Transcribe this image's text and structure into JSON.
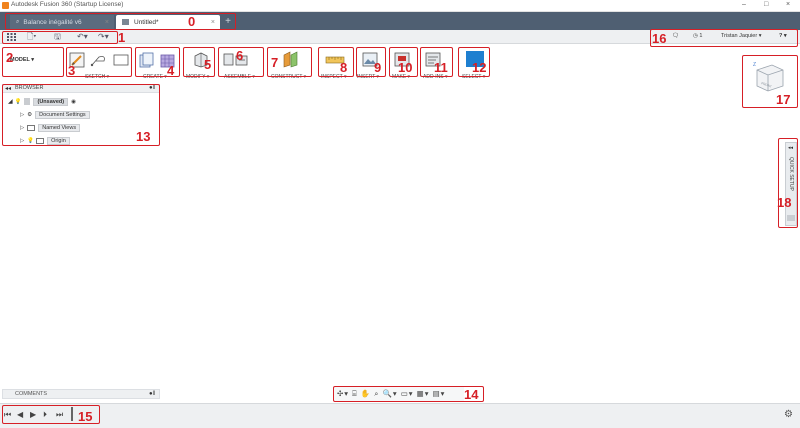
{
  "window": {
    "title": "Autodesk Fusion 360 (Startup License)",
    "controls": [
      "–",
      "□",
      "×"
    ]
  },
  "tabs": [
    {
      "label": "Balance inégalité v6",
      "active": false
    },
    {
      "label": "Untitled*",
      "active": true
    }
  ],
  "tab_close": "×",
  "new_tab": "+",
  "workspace": {
    "label": "MODEL ▾"
  },
  "ribbon": {
    "groups": [
      {
        "id": "sketch",
        "label": "SKETCH ▾"
      },
      {
        "id": "create",
        "label": "CREATE ▾"
      },
      {
        "id": "modify",
        "label": "MODIFY ▾"
      },
      {
        "id": "assemble",
        "label": "ASSEMBLE ▾"
      },
      {
        "id": "construct",
        "label": "CONSTRUCT ▾"
      },
      {
        "id": "inspect",
        "label": "INSPECT ▾"
      },
      {
        "id": "insert",
        "label": "INSERT ▾"
      },
      {
        "id": "make",
        "label": "MAKE ▾"
      },
      {
        "id": "addins",
        "label": "ADD-INS ▾"
      },
      {
        "id": "select",
        "label": "SELECT ▾"
      }
    ]
  },
  "user": {
    "job_count": "1",
    "name": "Tristan Jaquier ▾",
    "help": "? ▾"
  },
  "viewcube": {
    "face": "FRONT",
    "axis": "Z"
  },
  "browser": {
    "title": "BROWSER",
    "items": [
      {
        "label": "(Unsaved)"
      },
      {
        "label": "Document Settings"
      },
      {
        "label": "Named Views"
      },
      {
        "label": "Origin"
      }
    ]
  },
  "quick_setup": {
    "label": "QUICK SETUP"
  },
  "comments": {
    "title": "COMMENTS"
  },
  "callouts": [
    "0",
    "1",
    "2",
    "3",
    "4",
    "5",
    "6",
    "7",
    "8",
    "9",
    "10",
    "11",
    "12",
    "13",
    "14",
    "15",
    "16",
    "17",
    "18"
  ],
  "colors": {
    "callout": "#d61f26",
    "tabbar": "#4f5f72",
    "accent": "#f0831e",
    "select_blue": "#1e7fd0"
  }
}
